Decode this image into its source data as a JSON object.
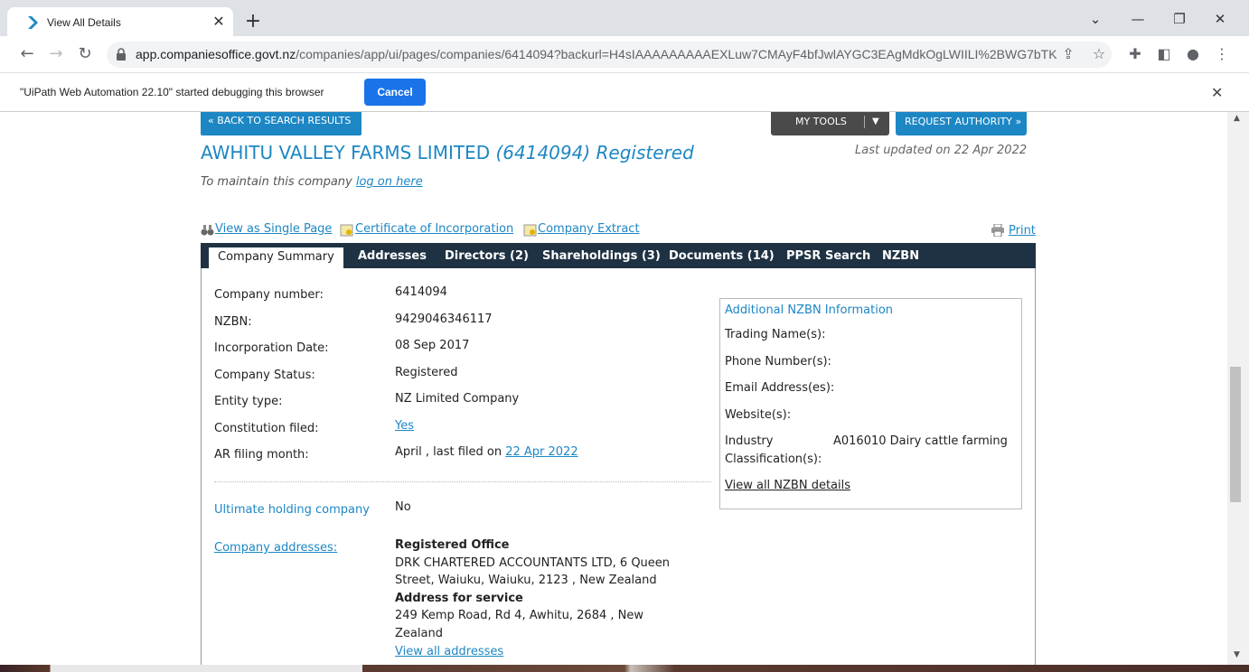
{
  "browser": {
    "tab_title": "View All Details",
    "url_host": "app.companiesoffice.govt.nz",
    "url_path": "/companies/app/ui/pages/companies/6414094?backurl=H4sIAAAAAAAAAEXLuw7CMAyF4bfJwlAYGC3EAgMdkOgLWIILI%2BWG7bTK2...",
    "infobar_text": "\"UiPath Web Automation 22.10\" started debugging this browser",
    "cancel_label": "Cancel"
  },
  "page": {
    "back_button": "« BACK TO SEARCH RESULTS",
    "tools_button": "MY TOOLS",
    "request_button": "REQUEST AUTHORITY »",
    "company_name": "AWHITU VALLEY FARMS LIMITED",
    "company_id": "(6414094)",
    "company_status_title": "Registered",
    "last_updated": "Last updated on 22 Apr 2022",
    "maintain_prefix": "To maintain this company",
    "maintain_link": "log on here",
    "links": {
      "single_page": "View as Single Page",
      "certificate": "Certificate of Incorporation",
      "extract": "Company Extract",
      "print": "Print"
    },
    "tabs": [
      "Company Summary",
      "Addresses",
      "Directors (2)",
      "Shareholdings (3)",
      "Documents (14)",
      "PPSR Search",
      "NZBN"
    ],
    "summary": {
      "company_number_label": "Company number:",
      "company_number": "6414094",
      "nzbn_label": "NZBN:",
      "nzbn": "9429046346117",
      "incorporation_label": "Incorporation Date:",
      "incorporation": "08 Sep 2017",
      "status_label": "Company Status:",
      "status": "Registered",
      "entity_label": "Entity type:",
      "entity": "NZ Limited Company",
      "constitution_label": "Constitution filed:",
      "constitution": "Yes",
      "ar_label": "AR filing month:",
      "ar_prefix": "April , last filed on",
      "ar_date": "22 Apr 2022",
      "holding_label": "Ultimate holding company",
      "holding": "No",
      "addresses_label": "Company addresses:",
      "registered_office_heading": "Registered Office",
      "registered_office_line1": "DRK CHARTERED ACCOUNTANTS LTD, 6 Queen",
      "registered_office_line2": "Street, Waiuku, Waiuku, 2123 , New Zealand",
      "service_heading": "Address for service",
      "service_line1": "249 Kemp Road, Rd 4, Awhitu, 2684 , New",
      "service_line2": "Zealand",
      "view_all_addresses": "View all addresses"
    },
    "nzbn_info": {
      "title": "Additional NZBN Information",
      "trading": "Trading Name(s):",
      "phone": "Phone Number(s):",
      "email": "Email Address(es):",
      "website": "Website(s):",
      "industry_label_1": "Industry",
      "industry_label_2": "Classification(s):",
      "industry_value": "A016010 Dairy cattle farming",
      "view_all": "View all NZBN details"
    }
  }
}
